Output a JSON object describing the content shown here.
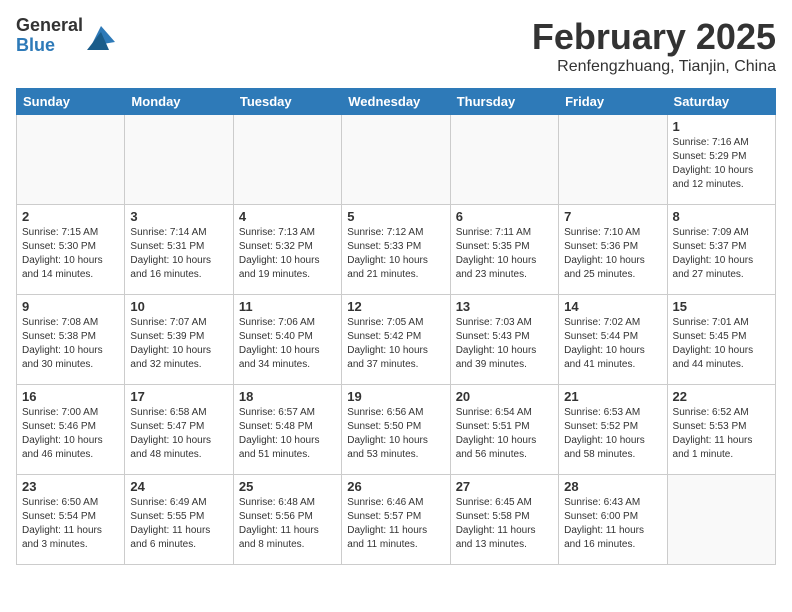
{
  "logo": {
    "general": "General",
    "blue": "Blue"
  },
  "title": {
    "month": "February 2025",
    "location": "Renfengzhuang, Tianjin, China"
  },
  "weekdays": [
    "Sunday",
    "Monday",
    "Tuesday",
    "Wednesday",
    "Thursday",
    "Friday",
    "Saturday"
  ],
  "weeks": [
    [
      {
        "day": "",
        "info": ""
      },
      {
        "day": "",
        "info": ""
      },
      {
        "day": "",
        "info": ""
      },
      {
        "day": "",
        "info": ""
      },
      {
        "day": "",
        "info": ""
      },
      {
        "day": "",
        "info": ""
      },
      {
        "day": "1",
        "info": "Sunrise: 7:16 AM\nSunset: 5:29 PM\nDaylight: 10 hours and 12 minutes."
      }
    ],
    [
      {
        "day": "2",
        "info": "Sunrise: 7:15 AM\nSunset: 5:30 PM\nDaylight: 10 hours and 14 minutes."
      },
      {
        "day": "3",
        "info": "Sunrise: 7:14 AM\nSunset: 5:31 PM\nDaylight: 10 hours and 16 minutes."
      },
      {
        "day": "4",
        "info": "Sunrise: 7:13 AM\nSunset: 5:32 PM\nDaylight: 10 hours and 19 minutes."
      },
      {
        "day": "5",
        "info": "Sunrise: 7:12 AM\nSunset: 5:33 PM\nDaylight: 10 hours and 21 minutes."
      },
      {
        "day": "6",
        "info": "Sunrise: 7:11 AM\nSunset: 5:35 PM\nDaylight: 10 hours and 23 minutes."
      },
      {
        "day": "7",
        "info": "Sunrise: 7:10 AM\nSunset: 5:36 PM\nDaylight: 10 hours and 25 minutes."
      },
      {
        "day": "8",
        "info": "Sunrise: 7:09 AM\nSunset: 5:37 PM\nDaylight: 10 hours and 27 minutes."
      }
    ],
    [
      {
        "day": "9",
        "info": "Sunrise: 7:08 AM\nSunset: 5:38 PM\nDaylight: 10 hours and 30 minutes."
      },
      {
        "day": "10",
        "info": "Sunrise: 7:07 AM\nSunset: 5:39 PM\nDaylight: 10 hours and 32 minutes."
      },
      {
        "day": "11",
        "info": "Sunrise: 7:06 AM\nSunset: 5:40 PM\nDaylight: 10 hours and 34 minutes."
      },
      {
        "day": "12",
        "info": "Sunrise: 7:05 AM\nSunset: 5:42 PM\nDaylight: 10 hours and 37 minutes."
      },
      {
        "day": "13",
        "info": "Sunrise: 7:03 AM\nSunset: 5:43 PM\nDaylight: 10 hours and 39 minutes."
      },
      {
        "day": "14",
        "info": "Sunrise: 7:02 AM\nSunset: 5:44 PM\nDaylight: 10 hours and 41 minutes."
      },
      {
        "day": "15",
        "info": "Sunrise: 7:01 AM\nSunset: 5:45 PM\nDaylight: 10 hours and 44 minutes."
      }
    ],
    [
      {
        "day": "16",
        "info": "Sunrise: 7:00 AM\nSunset: 5:46 PM\nDaylight: 10 hours and 46 minutes."
      },
      {
        "day": "17",
        "info": "Sunrise: 6:58 AM\nSunset: 5:47 PM\nDaylight: 10 hours and 48 minutes."
      },
      {
        "day": "18",
        "info": "Sunrise: 6:57 AM\nSunset: 5:48 PM\nDaylight: 10 hours and 51 minutes."
      },
      {
        "day": "19",
        "info": "Sunrise: 6:56 AM\nSunset: 5:50 PM\nDaylight: 10 hours and 53 minutes."
      },
      {
        "day": "20",
        "info": "Sunrise: 6:54 AM\nSunset: 5:51 PM\nDaylight: 10 hours and 56 minutes."
      },
      {
        "day": "21",
        "info": "Sunrise: 6:53 AM\nSunset: 5:52 PM\nDaylight: 10 hours and 58 minutes."
      },
      {
        "day": "22",
        "info": "Sunrise: 6:52 AM\nSunset: 5:53 PM\nDaylight: 11 hours and 1 minute."
      }
    ],
    [
      {
        "day": "23",
        "info": "Sunrise: 6:50 AM\nSunset: 5:54 PM\nDaylight: 11 hours and 3 minutes."
      },
      {
        "day": "24",
        "info": "Sunrise: 6:49 AM\nSunset: 5:55 PM\nDaylight: 11 hours and 6 minutes."
      },
      {
        "day": "25",
        "info": "Sunrise: 6:48 AM\nSunset: 5:56 PM\nDaylight: 11 hours and 8 minutes."
      },
      {
        "day": "26",
        "info": "Sunrise: 6:46 AM\nSunset: 5:57 PM\nDaylight: 11 hours and 11 minutes."
      },
      {
        "day": "27",
        "info": "Sunrise: 6:45 AM\nSunset: 5:58 PM\nDaylight: 11 hours and 13 minutes."
      },
      {
        "day": "28",
        "info": "Sunrise: 6:43 AM\nSunset: 6:00 PM\nDaylight: 11 hours and 16 minutes."
      },
      {
        "day": "",
        "info": ""
      }
    ]
  ]
}
